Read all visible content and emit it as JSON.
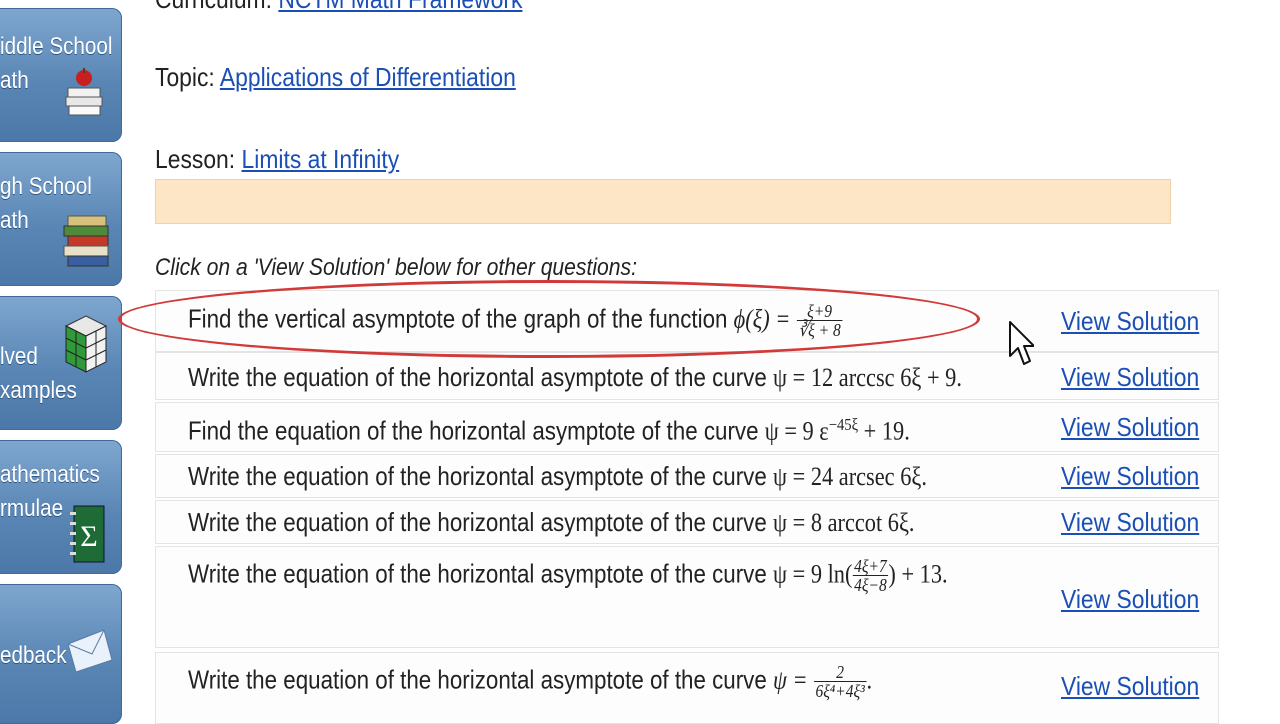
{
  "sidebar": {
    "items": [
      {
        "line1": "iddle School",
        "line2": "ath",
        "icon": "books-apple-icon"
      },
      {
        "line1": "gh School",
        "line2": "ath",
        "icon": "book-stack-icon"
      },
      {
        "line1": "lved",
        "line2": "xamples",
        "icon": "puzzle-cube-icon"
      },
      {
        "line1": "athematics",
        "line2": "rmulae",
        "icon": "sigma-notebook-icon"
      },
      {
        "line1": "edback",
        "line2": "",
        "icon": "envelope-icon"
      }
    ]
  },
  "header": {
    "curriculum_label": "Curriculum:",
    "curriculum_link": "NCTM Math Framework",
    "topic_label": "Topic:",
    "topic_link": "Applications of Differentiation",
    "lesson_label": "Lesson:",
    "lesson_link": "Limits at Infinity"
  },
  "instruction": "Click on a 'View Solution' below for other questions:",
  "questions": [
    {
      "text": "Find the vertical asymptote of the graph of the function",
      "var": "ϕ(ξ) =",
      "num": "ξ+9",
      "den": "∛ξ + 8",
      "tail": ""
    },
    {
      "text": "Write the equation of the horizontal asymptote of the curve",
      "expr": "ψ = 12 arccsc 6ξ + 9."
    },
    {
      "text": "Find the equation of the horizontal asymptote of the curve",
      "expr": "ψ = 9 ε",
      "sup": "−45ξ",
      "tail": " + 19."
    },
    {
      "text": "Write the equation of the horizontal asymptote of the curve",
      "expr": "ψ = 24 arcsec 6ξ."
    },
    {
      "text": "Write the equation of the horizontal asymptote of the curve",
      "expr": "ψ = 8 arccot 6ξ."
    },
    {
      "text": "Write the equation of the horizontal asymptote of the curve",
      "var": "ψ = 9 ln(",
      "num": "4ξ+7",
      "den": "4ξ−8",
      "tail": ") + 13."
    },
    {
      "text": "Write the equation of the horizontal asymptote of the curve",
      "var": "ψ =",
      "num": "2",
      "den": "6ξ⁴+4ξ³",
      "tail": "."
    }
  ],
  "view_solution_label": "View Solution",
  "colors": {
    "link": "#1a4fb5",
    "banner": "#fde6c6",
    "annotation": "#d23a3a",
    "sidebar": "#5a86b5"
  }
}
